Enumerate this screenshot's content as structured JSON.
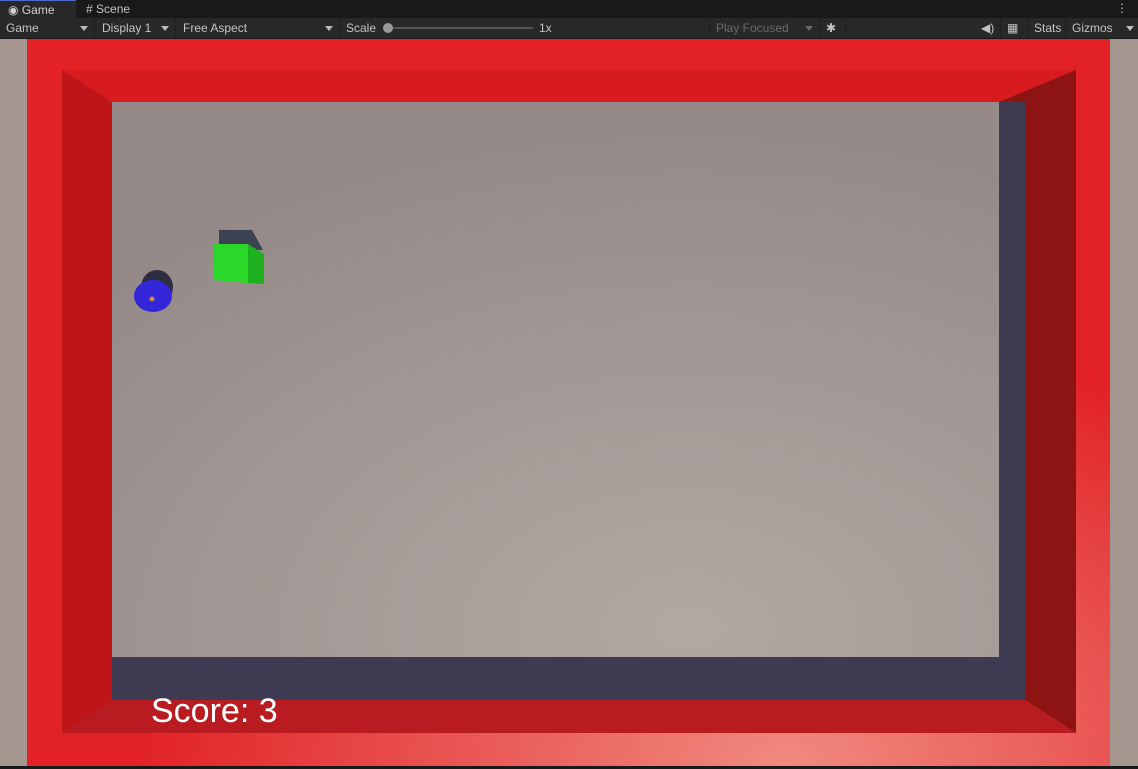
{
  "tabs": [
    {
      "label": "Game",
      "icon": "gamepad-icon"
    },
    {
      "label": "Scene",
      "icon": "grid-hash-icon"
    }
  ],
  "toolbar": {
    "view_mode": "Game",
    "display": "Display 1",
    "aspect": "Free Aspect",
    "scale_label": "Scale",
    "scale_value": "1x",
    "scale_fraction": 0.0,
    "play_mode": "Play Focused",
    "stats": "Stats",
    "gizmos": "Gizmos",
    "icons": [
      "bug-icon",
      "audio-mute-icon",
      "keyboard-icon",
      "more-vertical-icon"
    ]
  },
  "game": {
    "score_text": "Score: 3"
  },
  "colors": {
    "wall": "#e22226",
    "floor": "#a39792",
    "player": "#3326d8",
    "pickup": "#2ad82a"
  }
}
